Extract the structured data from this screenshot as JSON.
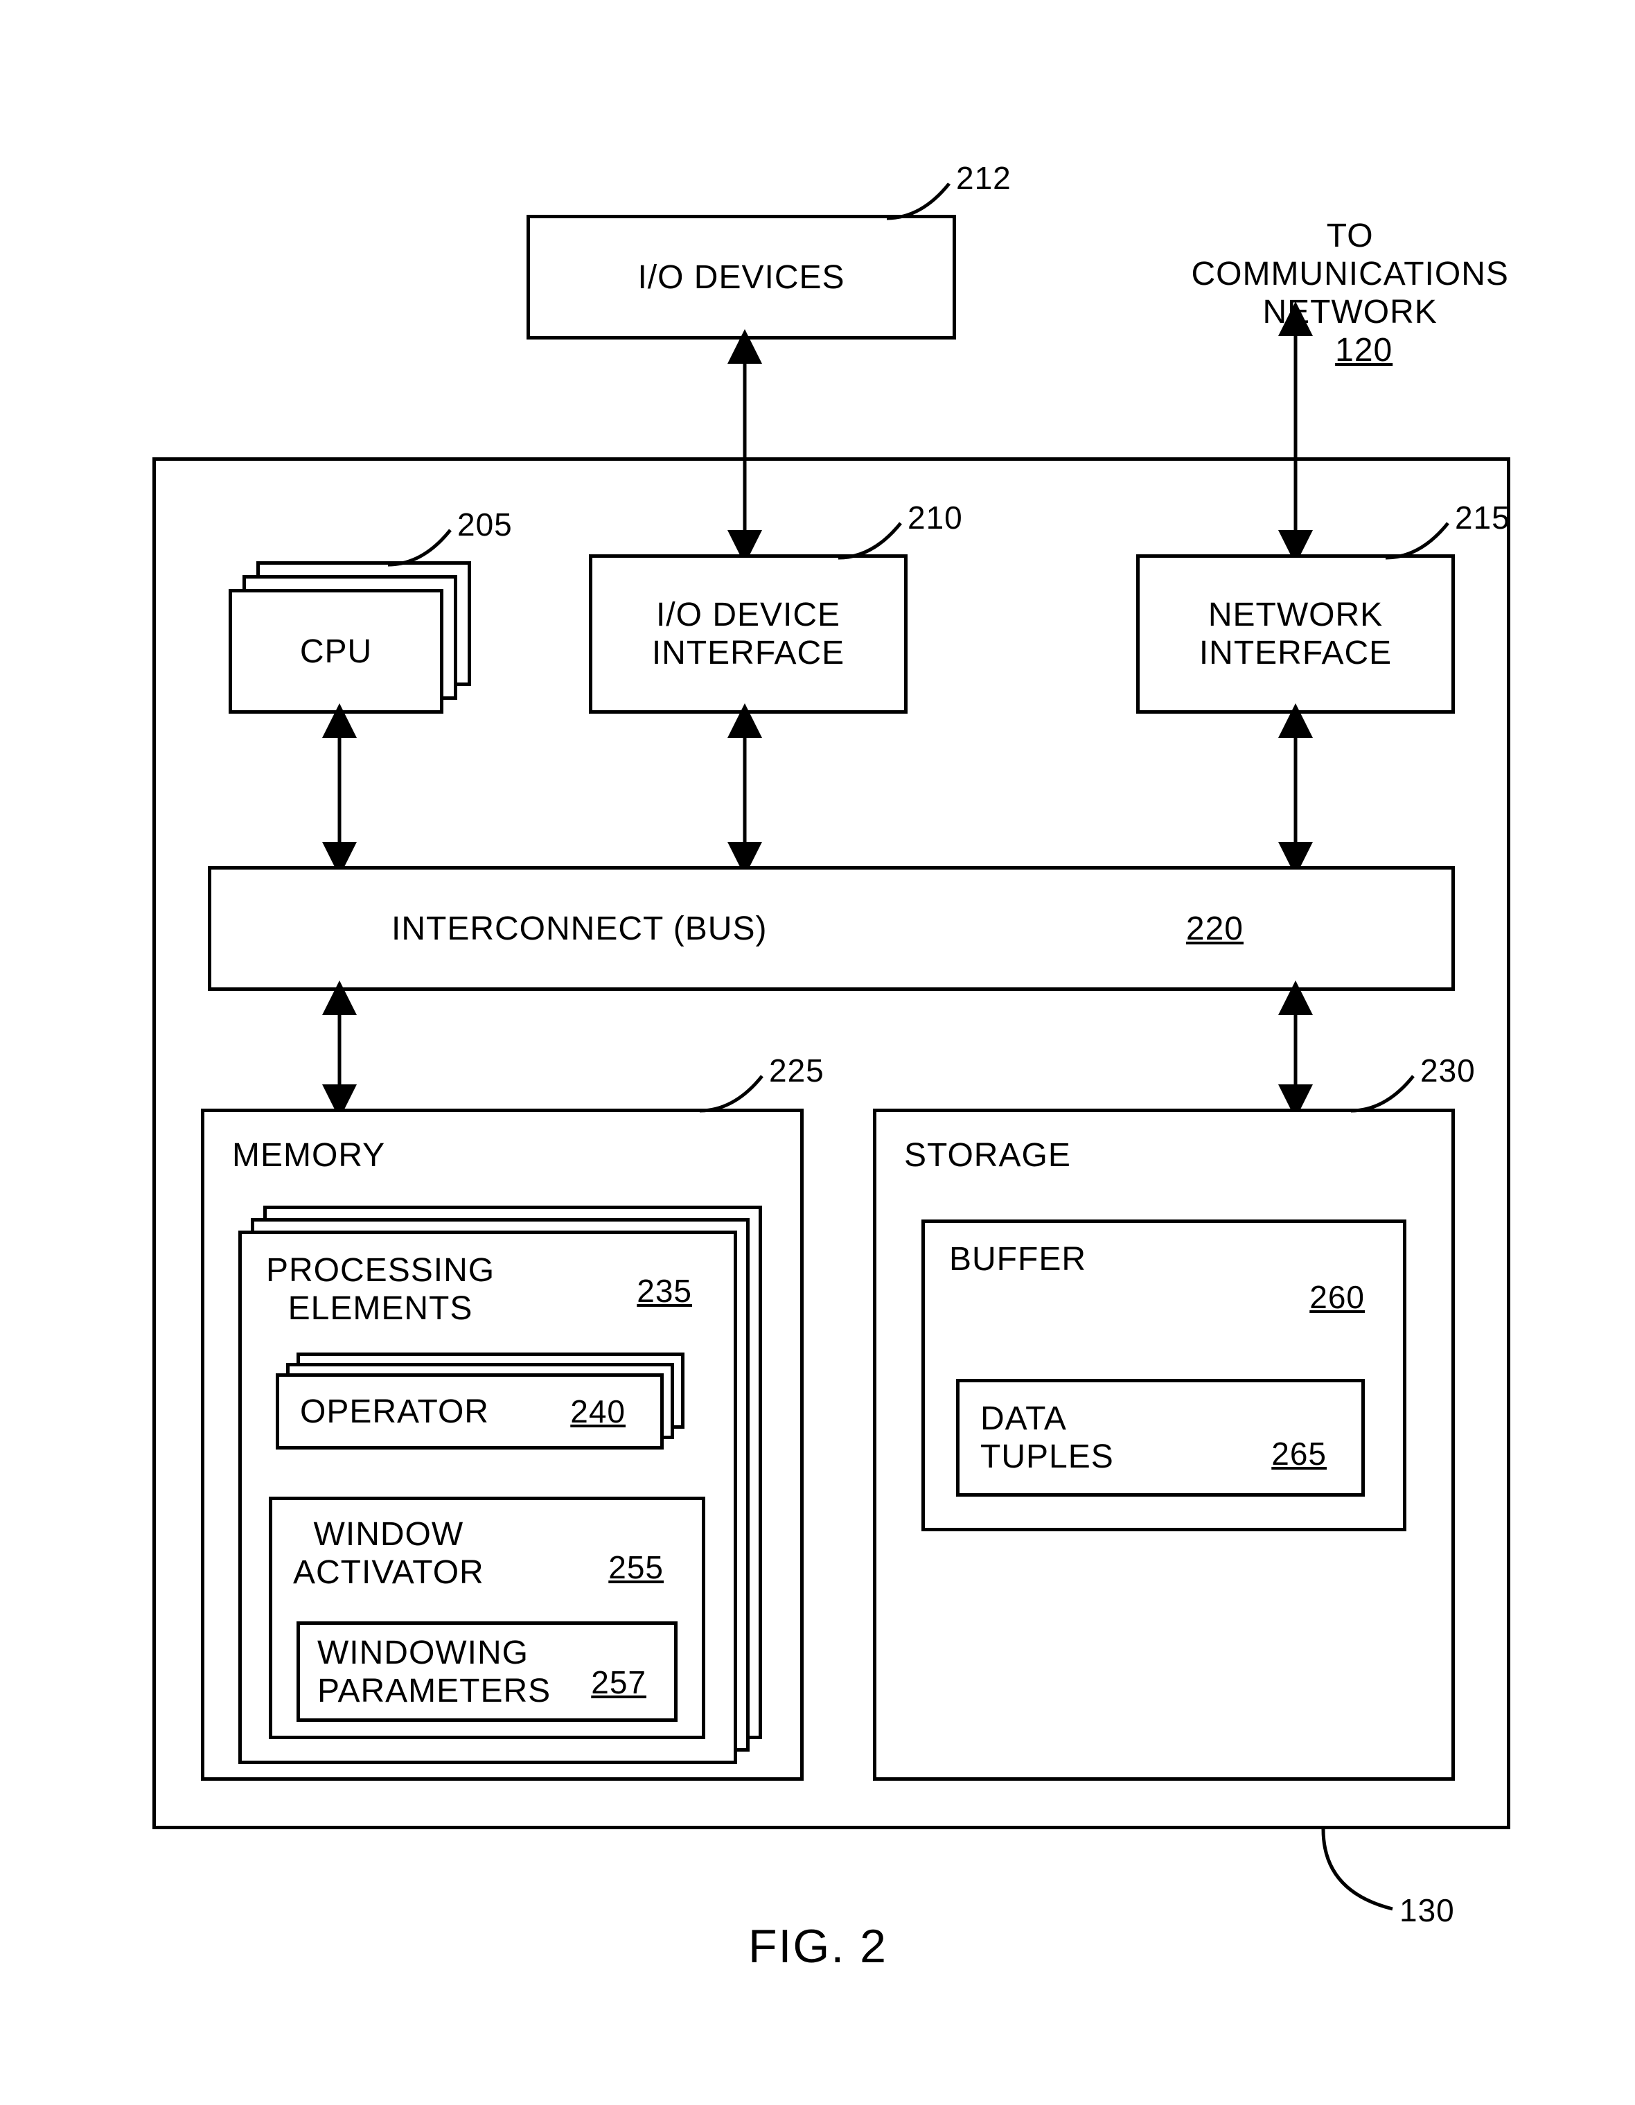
{
  "figure_caption": "FIG. 2",
  "ext": {
    "io_devices": "I/O DEVICES",
    "io_devices_ref": "212",
    "comm_text": "TO\nCOMMUNICATIONS\nNETWORK",
    "comm_ref": "120"
  },
  "chassis_ref": "130",
  "top_row": {
    "cpu": "CPU",
    "cpu_ref": "205",
    "io_iface": "I/O DEVICE\nINTERFACE",
    "io_iface_ref": "210",
    "net_iface": "NETWORK\nINTERFACE",
    "net_iface_ref": "215"
  },
  "bus": {
    "label": "INTERCONNECT (BUS)",
    "ref": "220"
  },
  "memory": {
    "title": "MEMORY",
    "ref": "225",
    "pe": {
      "title": "PROCESSING\nELEMENTS",
      "ref": "235",
      "operator": {
        "title": "OPERATOR",
        "ref": "240"
      },
      "winact": {
        "title": "WINDOW\nACTIVATOR",
        "ref": "255",
        "winparams": {
          "title": "WINDOWING\nPARAMETERS",
          "ref": "257"
        }
      }
    }
  },
  "storage": {
    "title": "STORAGE",
    "ref": "230",
    "buffer": {
      "title": "BUFFER",
      "ref": "260",
      "tuples": {
        "title": "DATA\nTUPLES",
        "ref": "265"
      }
    }
  }
}
